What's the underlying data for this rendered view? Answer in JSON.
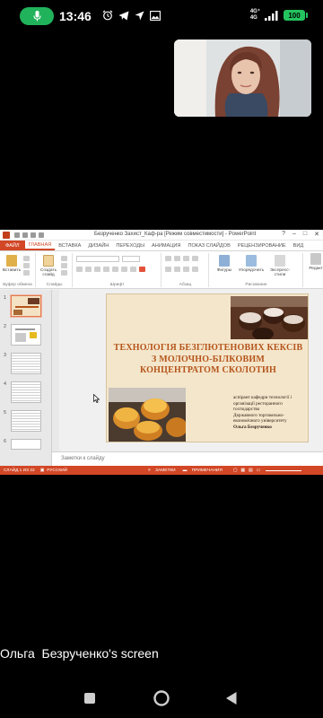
{
  "status_bar": {
    "time": "13:46",
    "signal_label": "4G⁺",
    "signal_label2": "4G",
    "battery": "100",
    "icons": [
      "mic-icon",
      "alarm-icon",
      "telegram-icon",
      "navigation-icon",
      "gallery-icon",
      "signal-icon",
      "battery-icon"
    ]
  },
  "screen_share": {
    "window_title": "Безрученко Захист_Каф-ра [Режим совместимости] - PowerPoint",
    "file_tab": "ФАЙЛ",
    "tabs": [
      "ГЛАВНАЯ",
      "ВСТАВКА",
      "ДИЗАЙН",
      "ПЕРЕХОДЫ",
      "АНИМАЦИЯ",
      "ПОКАЗ СЛАЙДОВ",
      "РЕЦЕНЗИРОВАНИЕ",
      "ВИД"
    ],
    "ribbon": {
      "paste": "Вставить",
      "create_slide": "Создать слайд",
      "shapes": "Фигуры",
      "arrange": "Упорядочить",
      "express_styles": "Экспресс-стили",
      "edit": "Редакт",
      "groups": [
        "Буфер обмена",
        "Слайды",
        "Шрифт",
        "Абзац",
        "Рисование"
      ]
    },
    "slide_numbers": [
      "1",
      "2",
      "3",
      "4",
      "5",
      "6"
    ],
    "slide": {
      "title_line1": "ТЕХНОЛОГІЯ БЕЗГЛЮТЕНОВИХ КЕКСІВ",
      "title_line2": "З МОЛОЧНО-БІЛКОВИМ",
      "title_line3": "КОНЦЕНТРАТОМ СКОЛОТИН",
      "author_line1": "аспірант кафедри технології і",
      "author_line2": "організації ресторанного",
      "author_line3": "господарства",
      "author_line4": "Державного торговельно-",
      "author_line5": "економічного університету",
      "author_name": "Ольга Безрученко"
    },
    "notes_placeholder": "Заметки к слайду",
    "statusbar": {
      "slide_counter": "СЛАЙД 1 ИЗ 22",
      "language": "РУССКИЙ",
      "notes_btn": "ЗАМЕТКИ",
      "comments_btn": "ПРИМЕЧАНИЯ"
    }
  },
  "screen_owner_label": "Ольга  Безрученко's screen",
  "colors": {
    "accent": "#d24726",
    "slide_bg": "#f4e6cb",
    "title_color": "#b5541a",
    "battery": "#23c45e",
    "mic_pill": "#21b35b"
  }
}
